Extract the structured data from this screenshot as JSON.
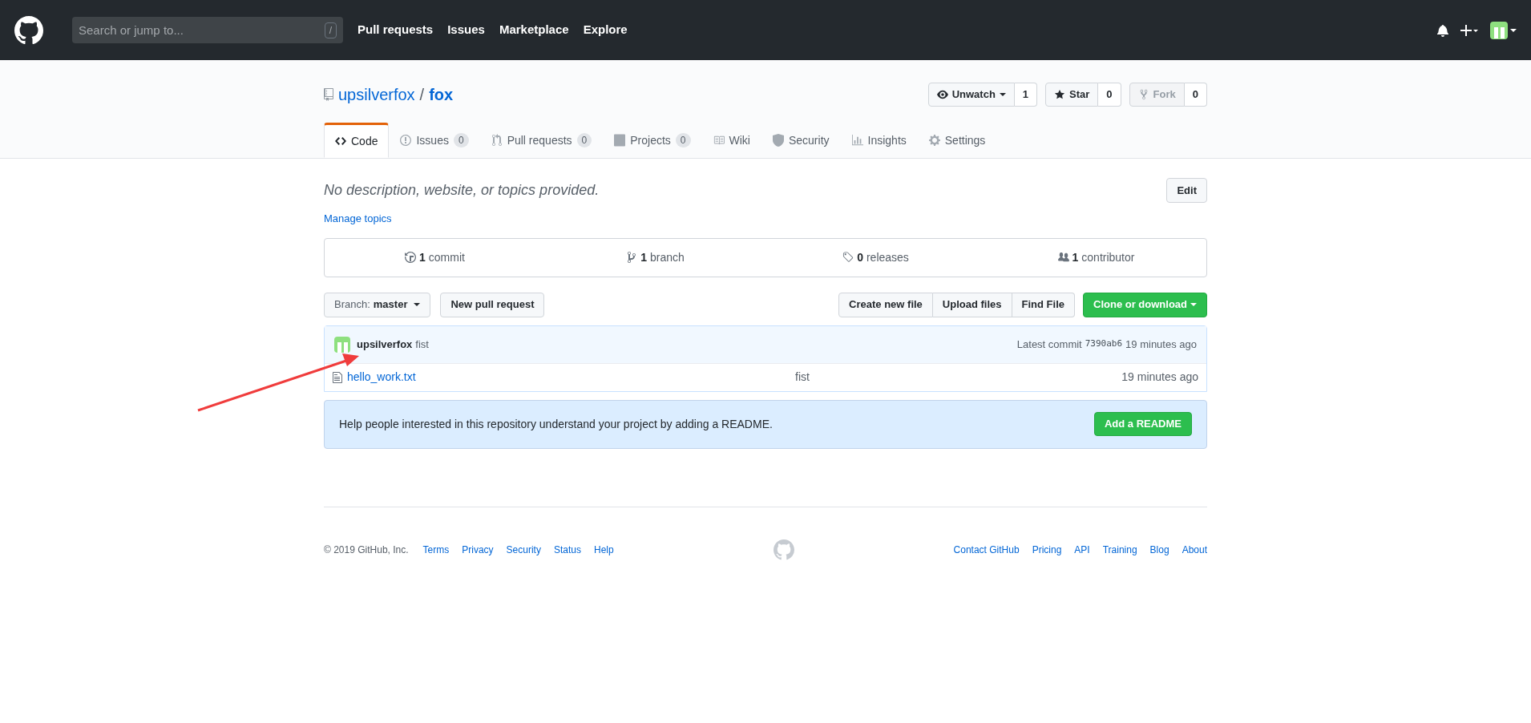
{
  "header": {
    "search": {
      "placeholder": "Search or jump to...",
      "shortcut": "/"
    },
    "nav": [
      "Pull requests",
      "Issues",
      "Marketplace",
      "Explore"
    ]
  },
  "repo": {
    "owner": "upsilverfox",
    "separator": "/",
    "name": "fox",
    "actions": [
      {
        "kind": "watch",
        "label": "Unwatch",
        "count": "1",
        "disabled": false
      },
      {
        "kind": "star",
        "label": "Star",
        "count": "0",
        "disabled": false
      },
      {
        "kind": "fork",
        "label": "Fork",
        "count": "0",
        "disabled": true
      }
    ]
  },
  "tabs": [
    {
      "kind": "code",
      "label": "Code",
      "selected": true
    },
    {
      "kind": "issues",
      "label": "Issues",
      "count": "0",
      "selected": false
    },
    {
      "kind": "pulls",
      "label": "Pull requests",
      "count": "0",
      "selected": false
    },
    {
      "kind": "projects",
      "label": "Projects",
      "count": "0",
      "selected": false
    },
    {
      "kind": "wiki",
      "label": "Wiki",
      "selected": false
    },
    {
      "kind": "security",
      "label": "Security",
      "selected": false
    },
    {
      "kind": "insights",
      "label": "Insights",
      "selected": false
    },
    {
      "kind": "settings",
      "label": "Settings",
      "selected": false
    }
  ],
  "description": {
    "text": "No description, website, or topics provided.",
    "edit_button": "Edit",
    "topics_link": "Manage topics"
  },
  "stats": [
    {
      "kind": "commits",
      "count": "1",
      "label": "commit"
    },
    {
      "kind": "branches",
      "count": "1",
      "label": "branch"
    },
    {
      "kind": "releases",
      "count": "0",
      "label": "releases"
    },
    {
      "kind": "contributors",
      "count": "1",
      "label": "contributor"
    }
  ],
  "toolbar": {
    "branch_label": "Branch:",
    "branch": "master",
    "new_pr": "New pull request",
    "file_buttons": [
      "Create new file",
      "Upload files",
      "Find File"
    ],
    "clone": "Clone or download"
  },
  "commit": {
    "author": "upsilverfox",
    "message": "fist",
    "latest_label": "Latest commit",
    "sha": "7390ab6",
    "age": "19 minutes ago"
  },
  "files": [
    {
      "name": "hello_work.txt",
      "message": "fist",
      "age": "19 minutes ago"
    }
  ],
  "readme_prompt": {
    "text": "Help people interested in this repository understand your project by adding a README.",
    "button": "Add a README"
  },
  "footer": {
    "copyright": "© 2019 GitHub, Inc.",
    "left_links": [
      "Terms",
      "Privacy",
      "Security",
      "Status",
      "Help"
    ],
    "right_links": [
      "Contact GitHub",
      "Pricing",
      "API",
      "Training",
      "Blog",
      "About"
    ]
  }
}
